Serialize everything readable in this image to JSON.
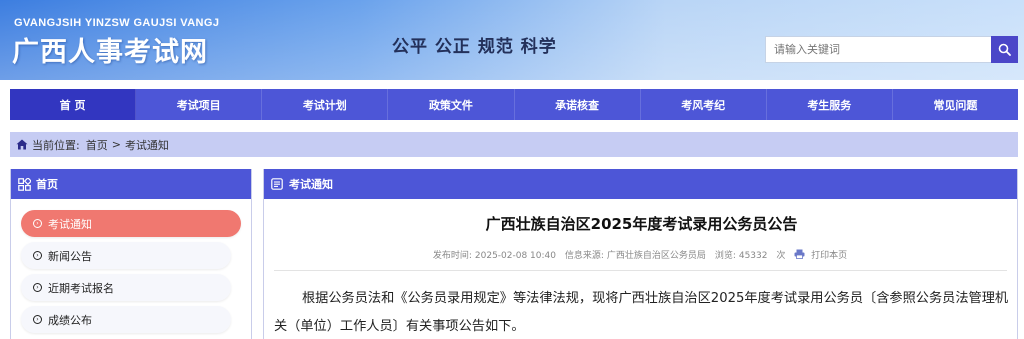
{
  "header": {
    "logo_en": "GVANGJSIH YINZSW GAUJSI VANGJ",
    "logo_cn": "广西人事考试网",
    "slogan": "公平  公正  规范  科学",
    "search_placeholder": "请输入关键词"
  },
  "nav": {
    "items": [
      "首 页",
      "考试项目",
      "考试计划",
      "政策文件",
      "承诺核查",
      "考风考纪",
      "考生服务",
      "常见问题"
    ],
    "active": "首 页"
  },
  "breadcrumb": {
    "label": "当前位置:",
    "home": "首页",
    "separator": ">",
    "current": "考试通知"
  },
  "sidebar": {
    "title": "首页",
    "items": [
      "考试通知",
      "新闻公告",
      "近期考试报名",
      "成绩公布"
    ],
    "active": "考试通知"
  },
  "main": {
    "section_title": "考试通知",
    "article_title": "广西壮族自治区2025年度考试录用公务员公告",
    "publish_label": "发布时间:",
    "publish_time": "2025-02-08 10:40",
    "source_label": "信息来源:",
    "source": "广西壮族自治区公务员局",
    "views_label": "浏览:",
    "views": "45332",
    "views_unit": "次",
    "print_label": "打印本页",
    "body": "根据公务员法和《公务员录用规定》等法律法规，现将广西壮族自治区2025年度考试录用公务员〔含参照公务员法管理机关（单位）工作人员〕有关事项公告如下。"
  },
  "colors": {
    "nav_bg": "#4d56d7",
    "nav_active": "#3236c0",
    "breadcrumb_bg": "#c6ccf3",
    "sidebar_active": "#f07870",
    "search_button": "#4b46c8"
  }
}
